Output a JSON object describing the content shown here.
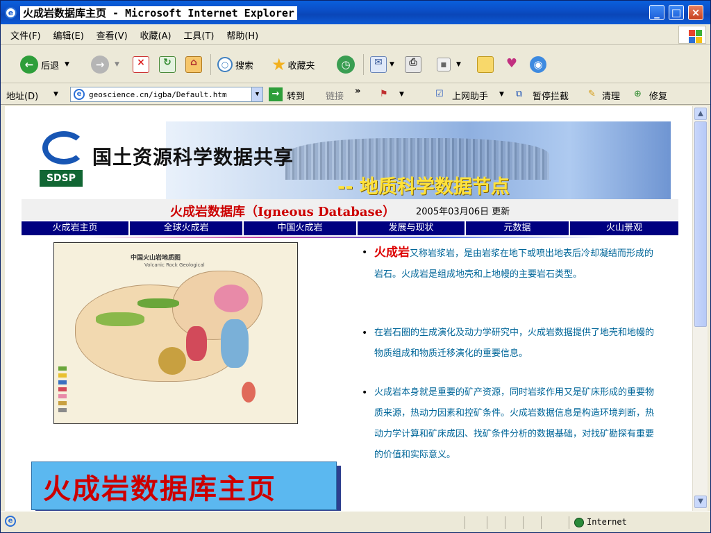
{
  "window": {
    "title": "火成岩数据库主页 - Microsoft Internet Explorer"
  },
  "menu": [
    "文件(F)",
    "编辑(E)",
    "查看(V)",
    "收藏(A)",
    "工具(T)",
    "帮助(H)"
  ],
  "toolbar": {
    "back": "后退",
    "search": "搜索",
    "favorites": "收藏夹"
  },
  "address": {
    "label": "地址(D)",
    "url": "geoscience.cn/igba/Default.htm",
    "go": "转到",
    "links": "链接",
    "links_chevron": "»",
    "helper": "上网助手",
    "popup": "暂停拦截",
    "clean": "清理",
    "repair": "修复"
  },
  "banner": {
    "logo_text": "SDSP",
    "main_title": "国土资源科学数据共享",
    "node_title": "-- 地质科学数据节点"
  },
  "db_title": "火成岩数据库（Igneous Database）",
  "update_date": "2005年03月06日 更新",
  "nav": [
    "火成岩主页",
    "全球火成岩",
    "中国火成岩",
    "发展与现状",
    "元数据",
    "火山景观"
  ],
  "map": {
    "title": "中国火山岩地质图",
    "subtitle": "Volcanic Rock Geological"
  },
  "bullets": [
    {
      "highlight": "火成岩",
      "text": "又称岩浆岩，是由岩浆在地下或喷出地表后冷却凝结而形成的岩石。火成岩是组成地壳和上地幔的主要岩石类型。"
    },
    {
      "highlight": "",
      "text": "在岩石圈的生成演化及动力学研究中，火成岩数据提供了地壳和地幔的物质组成和物质迁移演化的重要信息。"
    },
    {
      "highlight": "",
      "text": "火成岩本身就是重要的矿产资源，同时岩浆作用又是矿床形成的重要物质来源，热动力因素和控矿条件。火成岩数据信息是构造环境判断，热动力学计算和矿床成因、找矿条件分析的数据基础，对找矿勘探有重要的价值和实际意义。"
    }
  ],
  "big_title": "火成岩数据库主页",
  "status": {
    "zone": "Internet"
  },
  "colors": {
    "nav_bg": "#000080",
    "db_title": "#cc0000",
    "bullet_text": "#006699",
    "big_title_bg": "#5bb8f0"
  }
}
